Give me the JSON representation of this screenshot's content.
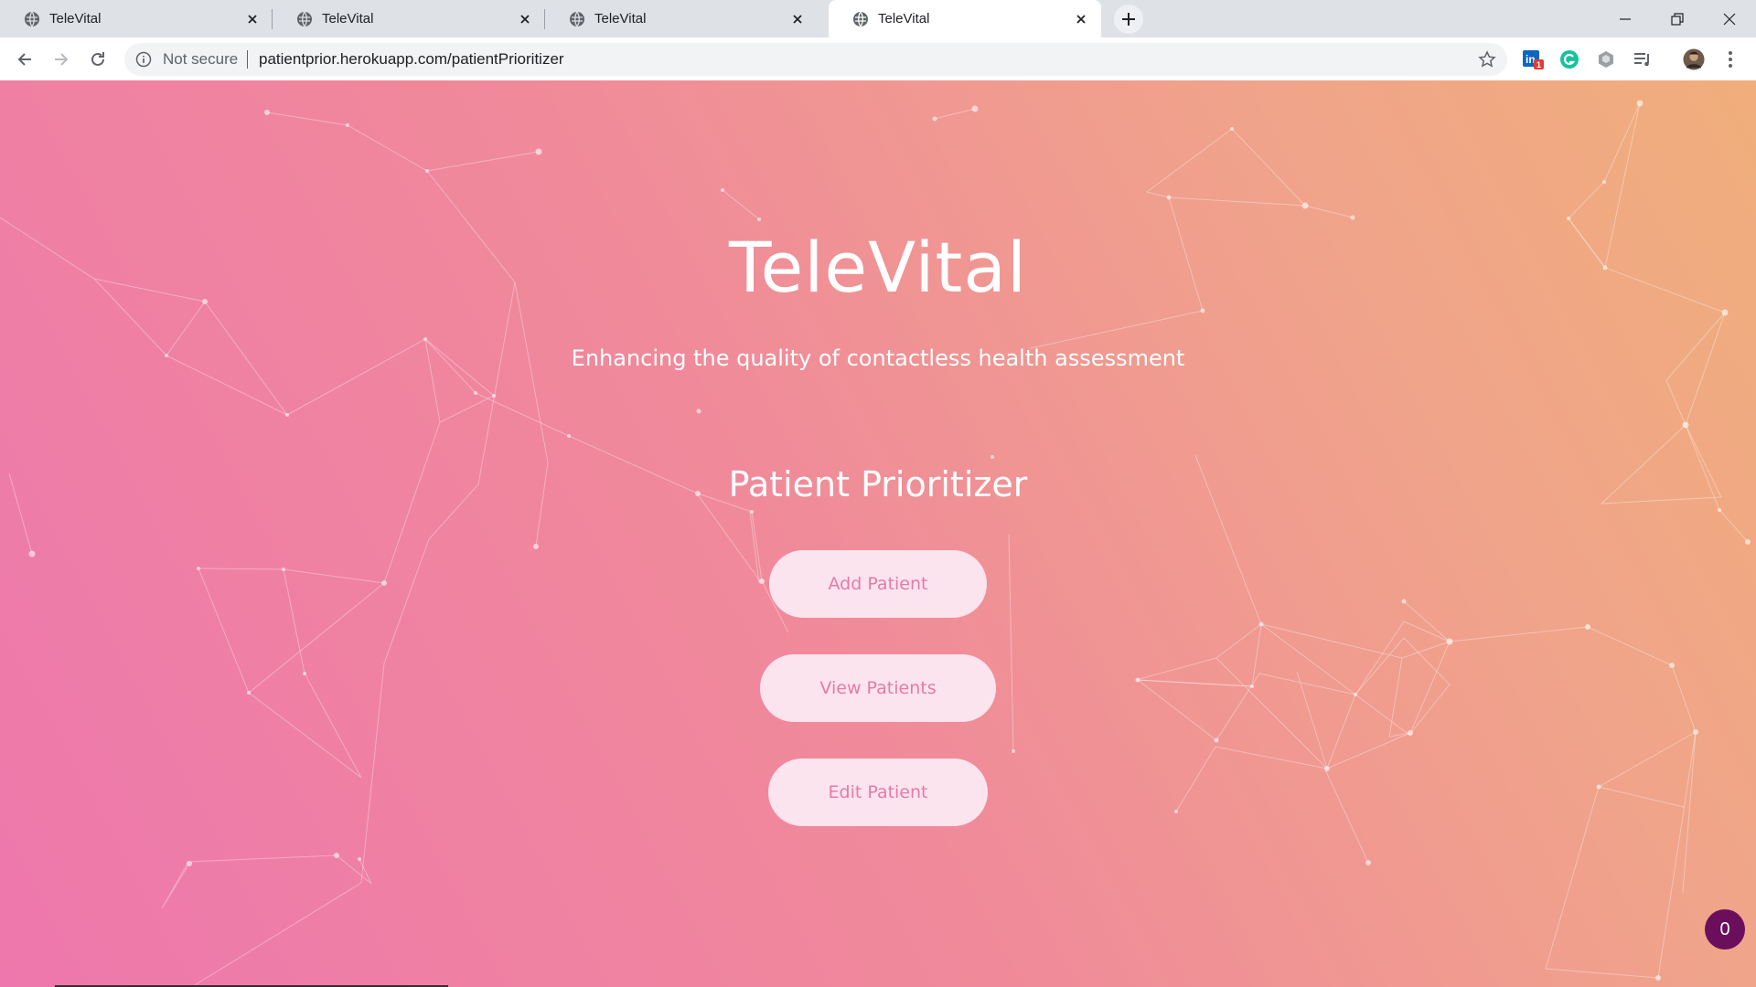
{
  "browser": {
    "tabs": [
      {
        "title": "TeleVital",
        "active": false
      },
      {
        "title": "TeleVital",
        "active": false
      },
      {
        "title": "TeleVital",
        "active": false
      },
      {
        "title": "TeleVital",
        "active": true
      }
    ],
    "address": {
      "security_label": "Not secure",
      "url": "patientprior.herokuapp.com/patientPrioritizer"
    },
    "extensions": [
      {
        "name": "linkedin-icon",
        "badge": "1"
      },
      {
        "name": "grammarly-icon"
      },
      {
        "name": "extension-icon"
      },
      {
        "name": "media-queue-icon"
      },
      {
        "name": "profile-avatar"
      },
      {
        "name": "menu-icon"
      }
    ]
  },
  "page": {
    "brand": "TeleVital",
    "tagline": "Enhancing the quality of contactless health assessment",
    "section_title": "Patient Prioritizer",
    "buttons": {
      "add": "Add Patient",
      "view": "View Patients",
      "edit": "Edit Patient"
    },
    "counter_badge": "0",
    "colors": {
      "gradient_start": "#ee77ad",
      "gradient_end": "#f0ae7b",
      "button_bg": "#fce4ef",
      "button_text": "#e67aa6",
      "badge_bg": "#6b0f5d"
    }
  }
}
